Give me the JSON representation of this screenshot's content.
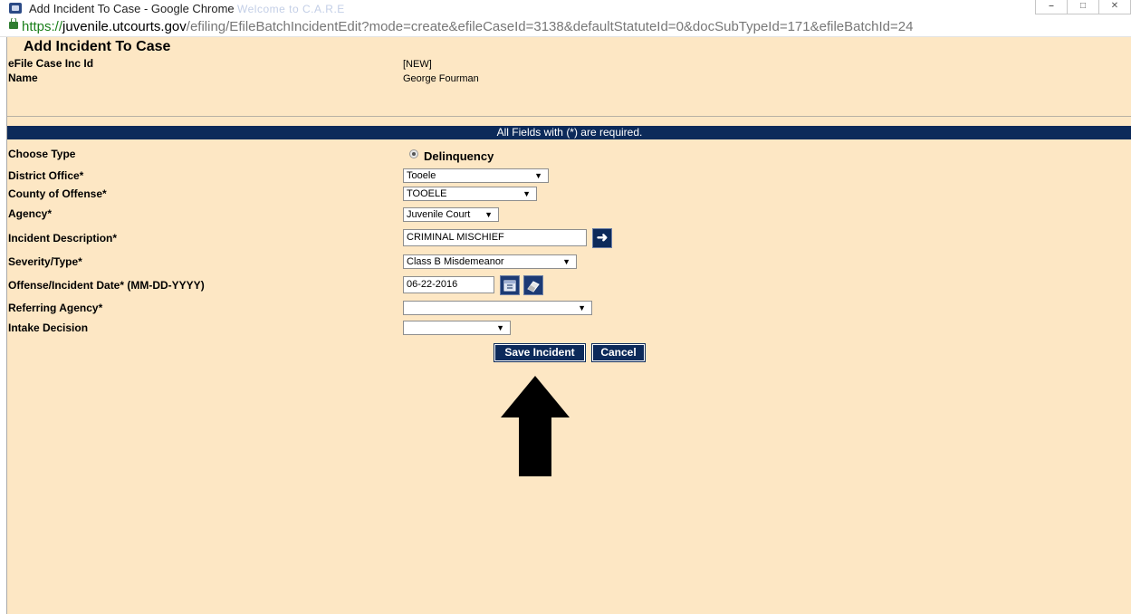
{
  "window": {
    "title": "Add Incident To Case - Google Chrome",
    "background_title": "Welcome to C.A.R.E"
  },
  "address_bar": {
    "scheme": "https://",
    "host": "juvenile.utcourts.gov",
    "path": "/efiling/EfileBatchIncidentEdit?mode=create&efileCaseId=3138&defaultStatuteId=0&docSubTypeId=171&efileBatchId=24"
  },
  "page": {
    "heading": "Add Incident To Case",
    "info": [
      {
        "label": "eFile Case Inc Id",
        "value": "[NEW]"
      },
      {
        "label": "Name",
        "value": "George Fourman"
      }
    ],
    "required_note": "All Fields with (*) are required.",
    "fields": {
      "choose_type": {
        "label": "Choose Type",
        "option": "Delinquency"
      },
      "district_office": {
        "label": "District Office*",
        "value": "Tooele"
      },
      "county": {
        "label": "County of Offense*",
        "value": "TOOELE"
      },
      "agency": {
        "label": "Agency*",
        "value": "Juvenile Court"
      },
      "incident_description": {
        "label": "Incident Description*",
        "value": "CRIMINAL MISCHIEF"
      },
      "severity": {
        "label": "Severity/Type*",
        "value": "Class B Misdemeanor"
      },
      "offense_date": {
        "label": "Offense/Incident Date* (MM-DD-YYYY)",
        "value": "06-22-2016"
      },
      "referring_agency": {
        "label": "Referring Agency*",
        "value": ""
      },
      "intake_decision": {
        "label": "Intake Decision",
        "value": ""
      }
    },
    "buttons": {
      "save": "Save Incident",
      "cancel": "Cancel"
    }
  },
  "colors": {
    "page_bg": "#fde7c4",
    "navy": "#0c2a5a"
  },
  "icons": {
    "lookup": "arrow-right-icon",
    "calendar": "calendar-icon",
    "clear": "eraser-icon",
    "annotation": "arrow-up-icon"
  }
}
